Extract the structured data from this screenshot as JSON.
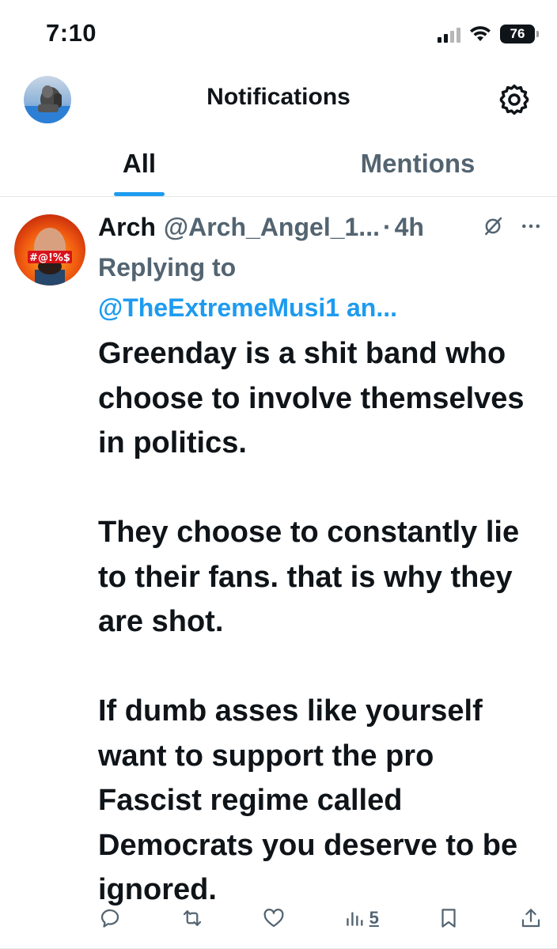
{
  "status_bar": {
    "time": "7:10",
    "battery": "76",
    "icons": [
      "signal-icon",
      "wifi-icon",
      "battery-icon"
    ]
  },
  "header": {
    "title": "Notifications",
    "avatar_icon": "profile-avatar",
    "settings_icon": "gear-icon"
  },
  "tabs": [
    {
      "label": "All",
      "active": true
    },
    {
      "label": "Mentions",
      "active": false
    }
  ],
  "tweet": {
    "display_name": "Arch",
    "handle": "@Arch_Angel_1...",
    "separator": "·",
    "time": "4h",
    "replying_label": "Replying to",
    "reply_target": "@TheExtremeMusi1 an...",
    "avatar_text": "#@!%$",
    "paragraphs": [
      "Greenday is a shit band who choose to involve themselves in politics.",
      "They choose to constantly lie to their fans.  that is why they are shot.",
      "If dumb asses like yourself want to support the pro Fascist regime called Democrats you deserve to be ignored."
    ],
    "actions": {
      "reply_icon": "reply-icon",
      "retweet_icon": "retweet-icon",
      "like_icon": "heart-icon",
      "views_icon": "views-icon",
      "views_count": "5",
      "bookmark_icon": "bookmark-icon",
      "share_icon": "share-icon"
    }
  },
  "colors": {
    "accent": "#1d9bf0",
    "text_primary": "#0f1419",
    "text_secondary": "#536471",
    "divider": "#e3e6e9"
  }
}
